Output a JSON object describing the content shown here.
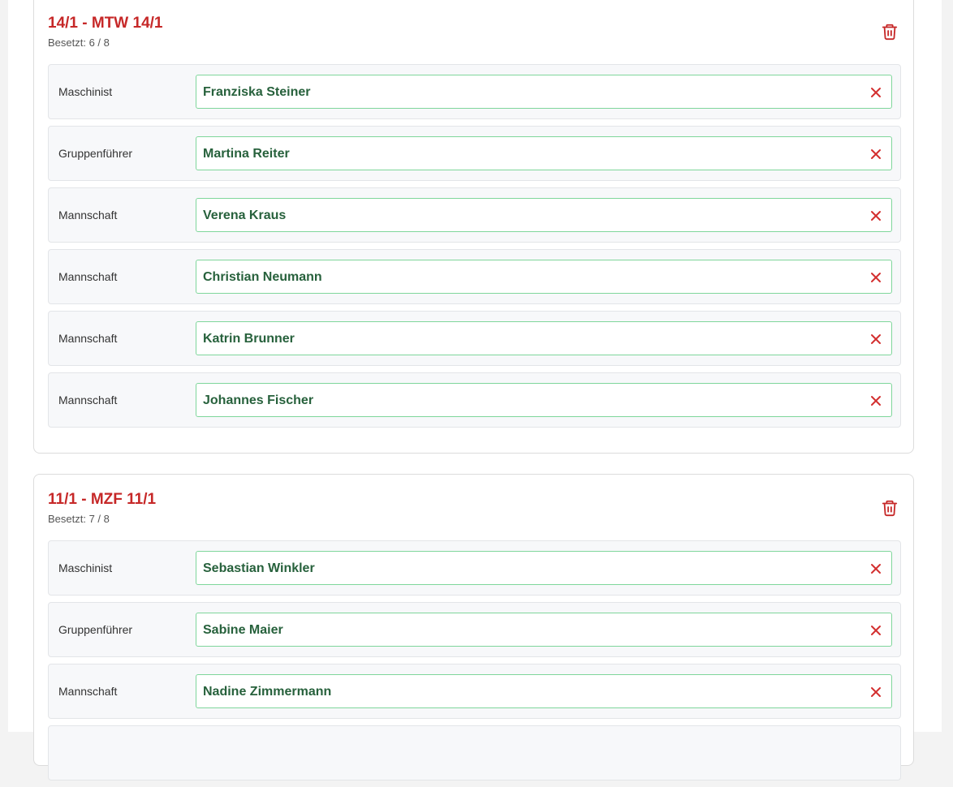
{
  "colors": {
    "title": "#c62828",
    "assignee_text": "#27613c",
    "assignee_border": "#7fd69b",
    "remove_icon": "#d32f2f",
    "delete_icon": "#c62828"
  },
  "icons": {
    "delete": "trash-icon",
    "remove": "close-icon"
  },
  "vehicles": [
    {
      "title": "14/1 - MTW 14/1",
      "occupancy": "Besetzt: 6 / 8",
      "slots": [
        {
          "role": "Maschinist",
          "assignee": "Franziska Steiner"
        },
        {
          "role": "Gruppenführer",
          "assignee": "Martina Reiter"
        },
        {
          "role": "Mannschaft",
          "assignee": "Verena Kraus"
        },
        {
          "role": "Mannschaft",
          "assignee": "Christian Neumann"
        },
        {
          "role": "Mannschaft",
          "assignee": "Katrin Brunner"
        },
        {
          "role": "Mannschaft",
          "assignee": "Johannes Fischer"
        }
      ]
    },
    {
      "title": "11/1 - MZF 11/1",
      "occupancy": "Besetzt: 7 / 8",
      "slots": [
        {
          "role": "Maschinist",
          "assignee": "Sebastian Winkler"
        },
        {
          "role": "Gruppenführer",
          "assignee": "Sabine Maier"
        },
        {
          "role": "Mannschaft",
          "assignee": "Nadine Zimmermann"
        },
        {
          "role": "",
          "assignee": ""
        }
      ]
    }
  ]
}
